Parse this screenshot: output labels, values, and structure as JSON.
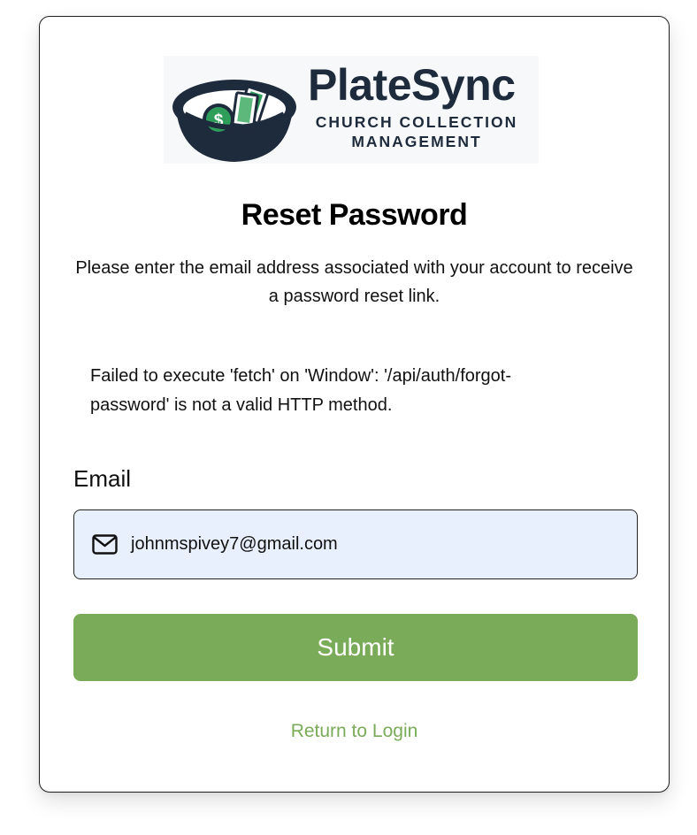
{
  "brand": {
    "name": "PlateSync",
    "tagline": "CHURCH COLLECTION MANAGEMENT",
    "logo_icon": "offering-plate-icon",
    "color": "#1e2b3c",
    "accent": "#2f9e5a"
  },
  "page": {
    "title": "Reset Password",
    "instructions": "Please enter the email address associated with your account to receive a password reset link.",
    "error_message": "Failed to execute 'fetch' on 'Window': '/api/auth/forgot-password' is not a valid HTTP method."
  },
  "form": {
    "email_label": "Email",
    "email_value": "johnmspivey7@gmail.com",
    "email_icon": "mail-icon",
    "submit_label": "Submit",
    "submit_color": "#7aab58"
  },
  "links": {
    "return_to_login": "Return to Login"
  }
}
